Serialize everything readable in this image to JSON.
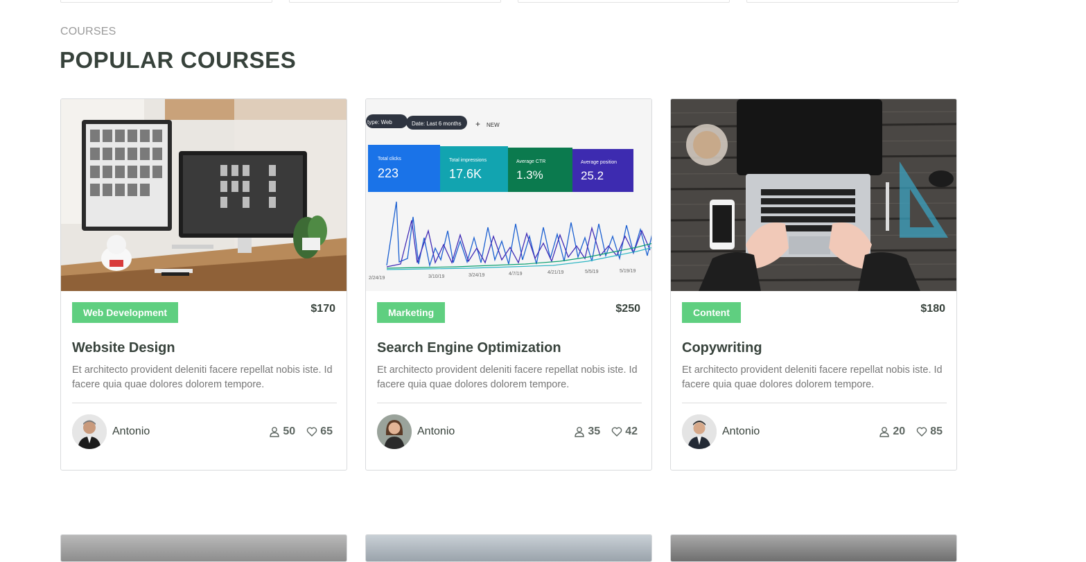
{
  "section": {
    "label": "COURSES",
    "title": "POPULAR COURSES"
  },
  "courses": [
    {
      "category": "Web Development",
      "price": "$170",
      "title": "Website Design",
      "description": "Et architecto provident deleniti facere repellat nobis iste. Id facere quia quae dolores dolorem tempore.",
      "trainer": "Antonio",
      "students": "50",
      "likes": "65"
    },
    {
      "category": "Marketing",
      "price": "$250",
      "title": "Search Engine Optimization",
      "description": "Et architecto provident deleniti facere repellat nobis iste. Id facere quia quae dolores dolorem tempore.",
      "trainer": "Antonio",
      "students": "35",
      "likes": "42"
    },
    {
      "category": "Content",
      "price": "$180",
      "title": "Copywriting",
      "description": "Et architecto provident deleniti facere repellat nobis iste. Id facere quia quae dolores dolorem tempore.",
      "trainer": "Antonio",
      "students": "20",
      "likes": "85"
    }
  ],
  "dashboard_image": {
    "filter_type": "type: Web",
    "filter_date": "Date: Last 6 months",
    "new_label": "NEW",
    "metrics": [
      {
        "label": "Total clicks",
        "value": "223",
        "color": "#1a73e8"
      },
      {
        "label": "Total impressions",
        "value": "17.6K",
        "color": "#12a4b0"
      },
      {
        "label": "Average CTR",
        "value": "1.3%",
        "color": "#0b7a4e"
      },
      {
        "label": "Average position",
        "value": "25.2",
        "color": "#3d2bb0"
      }
    ],
    "dates": [
      "2/24/19",
      "3/10/19",
      "3/24/19",
      "4/7/19",
      "4/21/19",
      "5/5/19",
      "5/19/19"
    ]
  },
  "colors": {
    "accent": "#5fcf80",
    "heading": "#37423b",
    "muted": "#777777"
  },
  "icons": {
    "students": "user-icon",
    "likes": "heart-icon"
  }
}
